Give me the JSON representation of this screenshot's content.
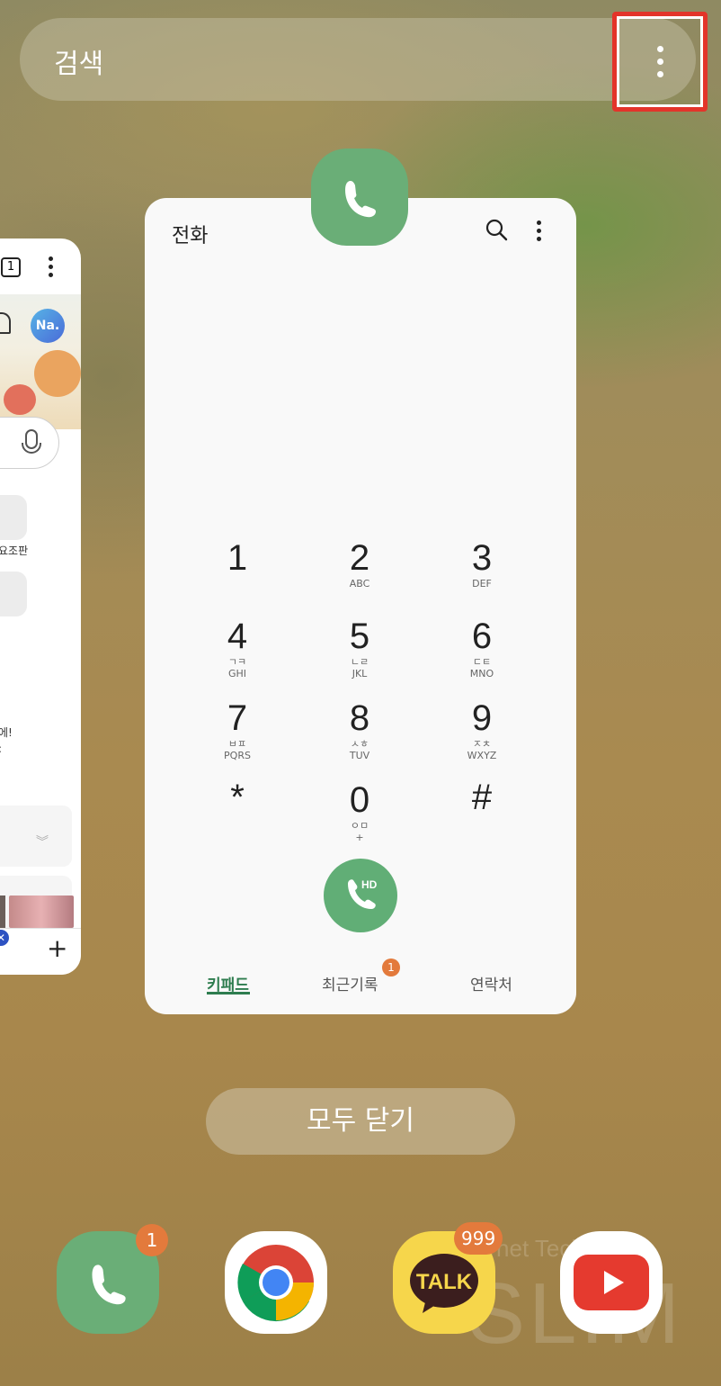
{
  "search": {
    "label": "검색"
  },
  "phone_card": {
    "title": "전화",
    "keypad": [
      {
        "digit": "1",
        "hangul": "",
        "latin": ""
      },
      {
        "digit": "2",
        "hangul": "",
        "latin": "ABC"
      },
      {
        "digit": "3",
        "hangul": "",
        "latin": "DEF"
      },
      {
        "digit": "4",
        "hangul": "ㄱㅋ",
        "latin": "GHI"
      },
      {
        "digit": "5",
        "hangul": "ㄴㄹ",
        "latin": "JKL"
      },
      {
        "digit": "6",
        "hangul": "ㄷㅌ",
        "latin": "MNO"
      },
      {
        "digit": "7",
        "hangul": "ㅂㅍ",
        "latin": "PQRS"
      },
      {
        "digit": "8",
        "hangul": "ㅅㅎ",
        "latin": "TUV"
      },
      {
        "digit": "9",
        "hangul": "ㅈㅊ",
        "latin": "WXYZ"
      },
      {
        "digit": "*",
        "hangul": "",
        "latin": ""
      },
      {
        "digit": "0",
        "hangul": "ㅇㅁ",
        "latin": "+"
      },
      {
        "digit": "#",
        "hangul": "",
        "latin": ""
      }
    ],
    "call_label": "HD",
    "tabs": {
      "keypad": "키패드",
      "recent": "최근기록",
      "contacts": "연락처"
    },
    "recent_badge": "1"
  },
  "left_card": {
    "tab_count": "1",
    "avatar": "Na.",
    "text_board": "요조판",
    "text_line1": "에!",
    "text_line2": ":"
  },
  "close_all": "모두 닫기",
  "dock": {
    "phone_badge": "1",
    "talk_label": "TALK",
    "talk_badge": "999"
  },
  "watermark": {
    "small": "Internet Technology",
    "large": "SLIM"
  },
  "colors": {
    "accent_green": "#61ae76",
    "badge_orange": "#e37a3c",
    "highlight_red": "#e3342a"
  }
}
